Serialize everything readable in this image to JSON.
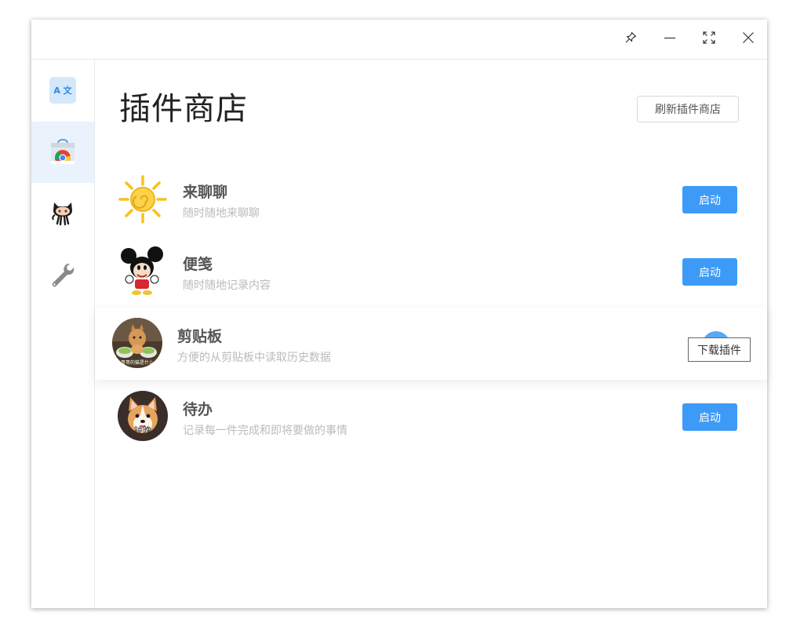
{
  "window": {
    "controls": [
      "pin-icon",
      "minimize-icon",
      "fullscreen-icon",
      "close-icon"
    ]
  },
  "sidebar": {
    "items": [
      {
        "name": "translate",
        "icon": "translate-icon",
        "label": "A 文"
      },
      {
        "name": "store",
        "icon": "chrome-store-icon",
        "active": true
      },
      {
        "name": "github",
        "icon": "octocat-icon"
      },
      {
        "name": "settings",
        "icon": "wrench-icon"
      }
    ]
  },
  "main": {
    "title": "插件商店",
    "refresh_label": "刷新插件商店",
    "plugins": [
      {
        "title": "来聊聊",
        "desc": "随时随地来聊聊",
        "action": "启动",
        "icon": "sun-icon"
      },
      {
        "title": "便笺",
        "desc": "随时随地记录内容",
        "action": "启动",
        "icon": "mickey-icon"
      },
      {
        "title": "剪贴板",
        "desc": "方便的从剪贴板中读取历史数据",
        "action": "download",
        "icon": "cat-photo-icon",
        "avatar_caption": "哥哥的猫是什么"
      },
      {
        "title": "待办",
        "desc": "记录每一件完成和即将要做的事情",
        "action": "启动",
        "icon": "corgi-photo-icon",
        "avatar_caption": "钟晚"
      }
    ],
    "tooltip": "下载插件"
  },
  "colors": {
    "accent": "#3d9bf7",
    "active_bg": "#eaf3fc"
  }
}
